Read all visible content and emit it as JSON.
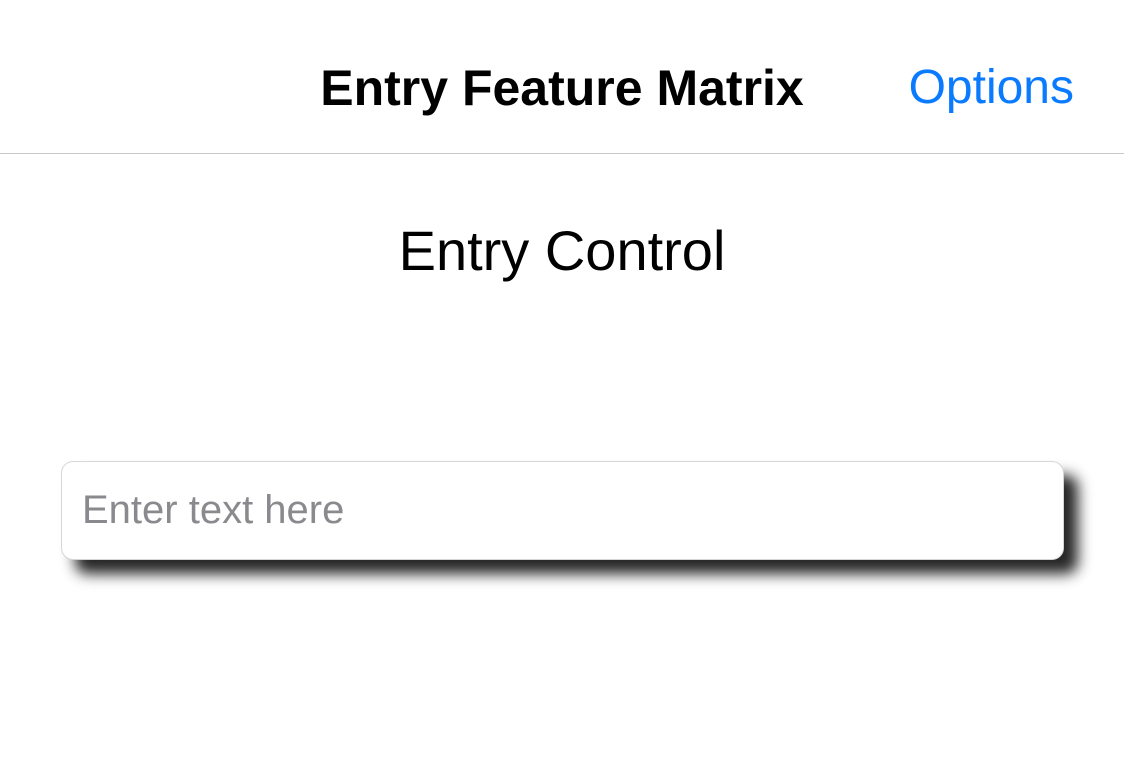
{
  "nav": {
    "title": "Entry Feature Matrix",
    "options_label": "Options"
  },
  "main": {
    "heading": "Entry Control",
    "entry": {
      "value": "",
      "placeholder": "Enter text here"
    }
  },
  "colors": {
    "accent": "#0a7aff",
    "placeholder": "#8a8a8e",
    "separator": "#c8c8cc"
  }
}
